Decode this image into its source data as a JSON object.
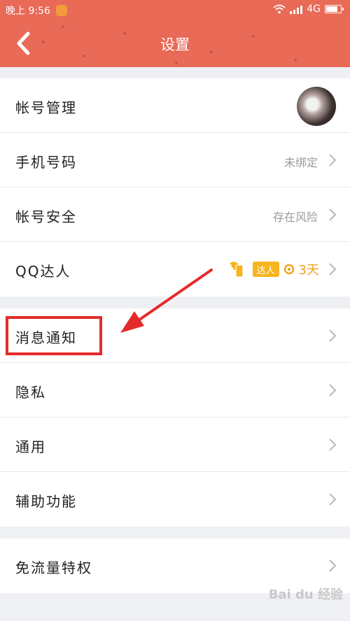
{
  "status_bar": {
    "time": "晚上 9:56",
    "network": "4G"
  },
  "header": {
    "title": "设置",
    "back_icon": "back-chevron-icon",
    "bg_color": "#e86a57"
  },
  "groups": [
    {
      "rows": [
        {
          "label": "帐号管理",
          "value": "",
          "extra": "avatar"
        },
        {
          "label": "手机号码",
          "value": "未绑定"
        },
        {
          "label": "帐号安全",
          "value": "存在风险"
        },
        {
          "label": "QQ达人",
          "badge": "达人",
          "days": "3天"
        }
      ]
    },
    {
      "rows": [
        {
          "label": "消息通知",
          "value": ""
        },
        {
          "label": "隐私",
          "value": ""
        },
        {
          "label": "通用",
          "value": ""
        },
        {
          "label": "辅助功能",
          "value": ""
        }
      ]
    },
    {
      "rows": [
        {
          "label": "免流量特权",
          "value": ""
        }
      ]
    }
  ],
  "annotation": {
    "highlight_color": "#e42b2b"
  },
  "watermark": "Bai du 经验"
}
